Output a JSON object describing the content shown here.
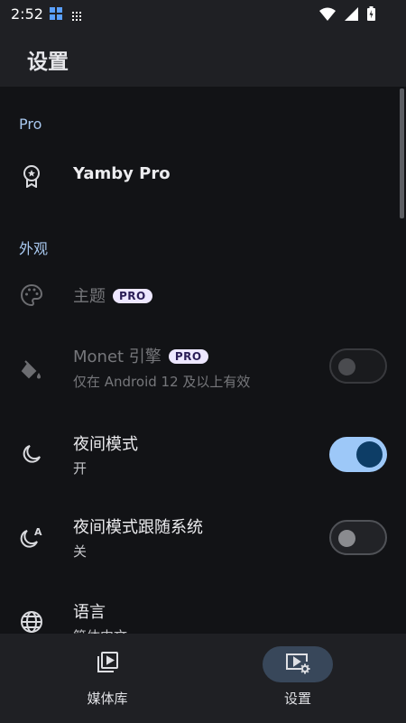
{
  "status": {
    "time": "2:52",
    "icons_left": [
      "widget-icon",
      "grid-icon"
    ],
    "icons_right": [
      "wifi-icon",
      "signal-icon",
      "battery-icon"
    ]
  },
  "appbar": {
    "title": "设置"
  },
  "sections": {
    "pro": {
      "header": "Pro"
    },
    "appearance": {
      "header": "外观"
    }
  },
  "items": {
    "yamby_pro": {
      "title": "Yamby Pro",
      "icon": "award-icon"
    },
    "theme": {
      "title": "主题",
      "badge": "PRO",
      "icon": "palette-icon"
    },
    "monet": {
      "title": "Monet 引擎",
      "badge": "PRO",
      "subtitle": "仅在 Android 12 及以上有效",
      "icon": "paint-bucket-icon",
      "switch": "off-disabled"
    },
    "night_mode": {
      "title": "夜间模式",
      "subtitle": "开",
      "icon": "moon-icon",
      "switch": "on"
    },
    "night_follow": {
      "title": "夜间模式跟随系统",
      "subtitle": "关",
      "icon": "moon-auto-icon",
      "switch": "off"
    },
    "language": {
      "title": "语言",
      "subtitle": "简体中文",
      "icon": "globe-icon"
    }
  },
  "bottom_nav": {
    "media": {
      "label": "媒体库",
      "icon": "video-library-icon"
    },
    "settings": {
      "label": "设置",
      "icon": "video-settings-icon",
      "active": true
    }
  },
  "colors": {
    "background": "#121316",
    "bar": "#1f2024",
    "section_header": "#a8c8ef",
    "switch_on_track": "#9dc8f8",
    "switch_on_thumb": "#0d3d66",
    "pro_badge_bg": "#ede7ff",
    "nav_active_pill": "#38475a"
  }
}
